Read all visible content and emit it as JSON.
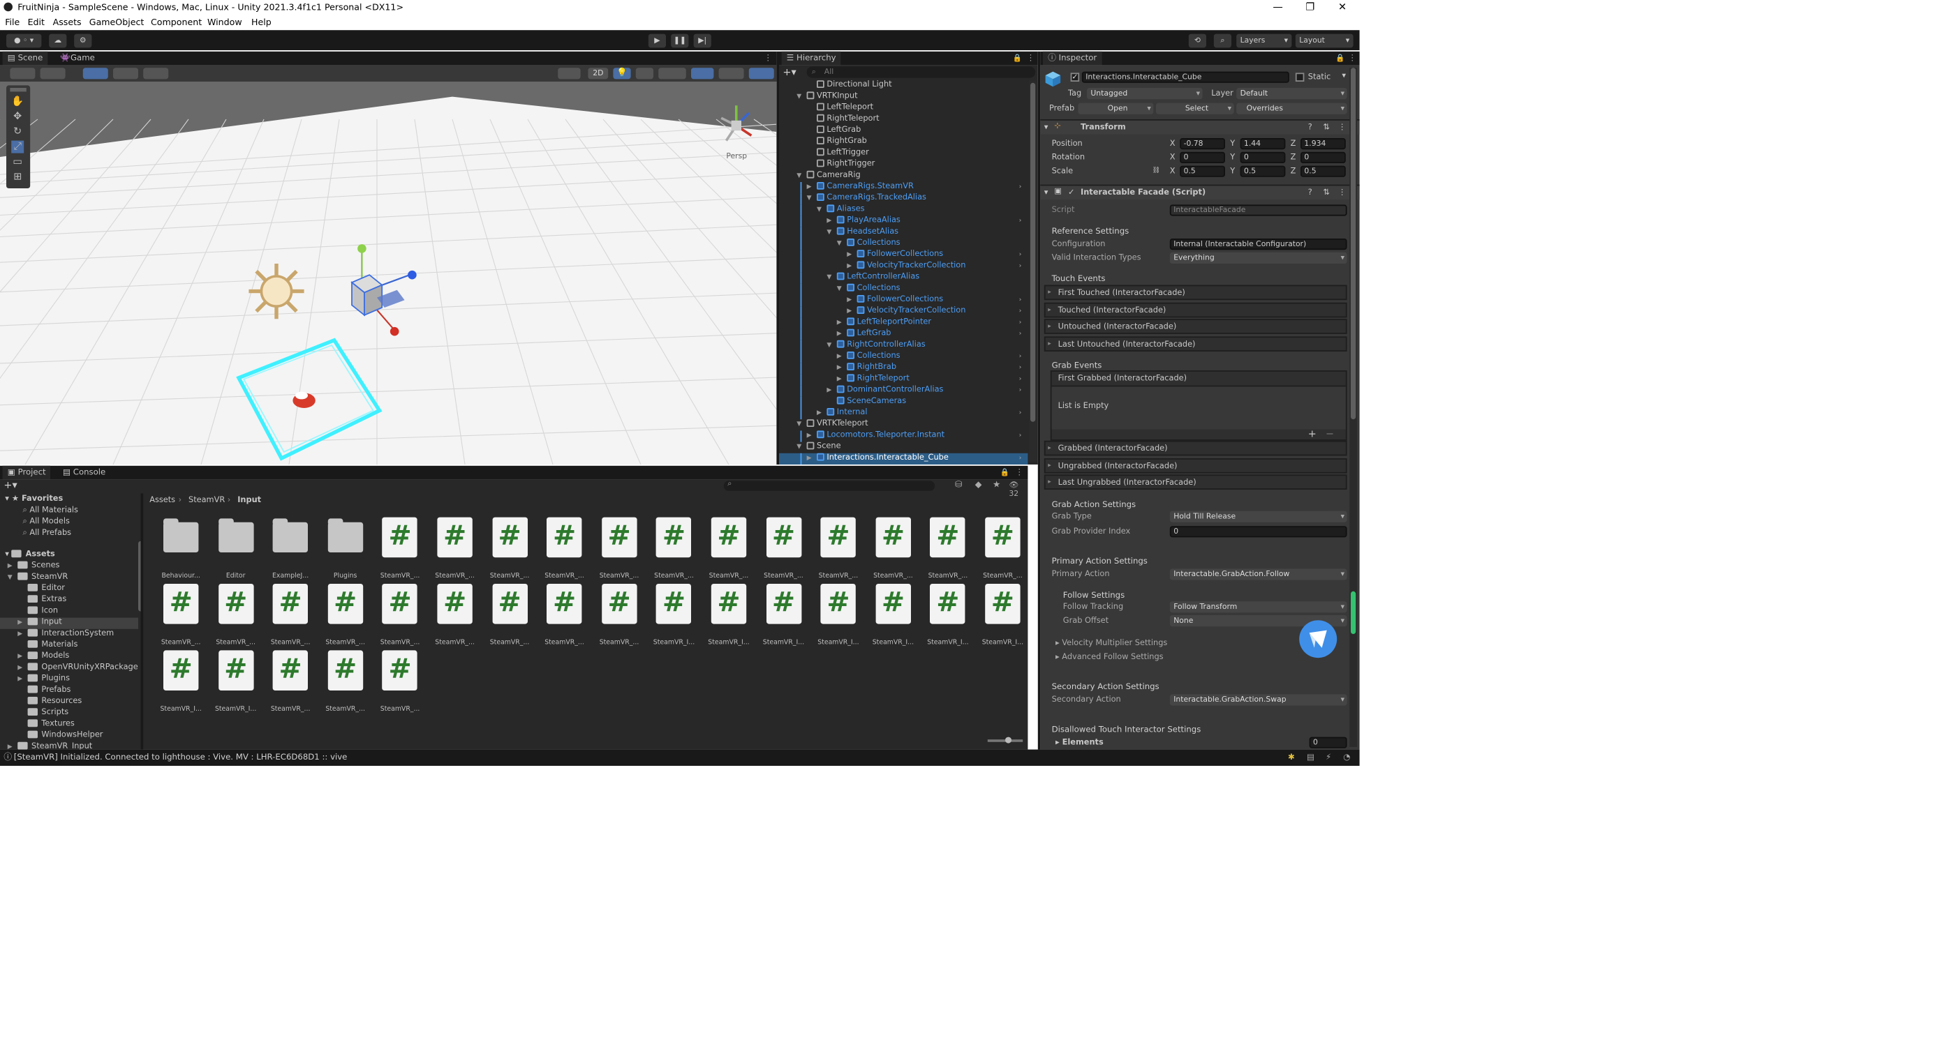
{
  "window": {
    "title": "FruitNinja - SampleScene - Windows, Mac, Linux - Unity 2021.3.4f1c1 Personal <DX11>"
  },
  "menu": [
    "File",
    "Edit",
    "Assets",
    "GameObject",
    "Component",
    "Window",
    "Help"
  ],
  "toolbar": {
    "layers": "Layers",
    "layout": "Layout"
  },
  "scene": {
    "tab_scene": "Scene",
    "tab_game": "Game",
    "persp": "Persp",
    "btn_2d": "2D"
  },
  "hierarchy": {
    "tab": "Hierarchy",
    "search": "All",
    "items": [
      {
        "label": "Directional Light",
        "indent": 2,
        "blue": false
      },
      {
        "label": "VRTKInput",
        "indent": 1,
        "blue": false,
        "open": true
      },
      {
        "label": "LeftTeleport",
        "indent": 2,
        "blue": false
      },
      {
        "label": "RightTeleport",
        "indent": 2,
        "blue": false
      },
      {
        "label": "LeftGrab",
        "indent": 2,
        "blue": false
      },
      {
        "label": "RightGrab",
        "indent": 2,
        "blue": false
      },
      {
        "label": "LeftTrigger",
        "indent": 2,
        "blue": false
      },
      {
        "label": "RightTrigger",
        "indent": 2,
        "blue": false
      },
      {
        "label": "CameraRig",
        "indent": 1,
        "blue": false,
        "open": true
      },
      {
        "label": "CameraRigs.SteamVR",
        "indent": 2,
        "blue": true,
        "closed": true
      },
      {
        "label": "CameraRigs.TrackedAlias",
        "indent": 2,
        "blue": true,
        "open": true
      },
      {
        "label": "Aliases",
        "indent": 3,
        "blue": true,
        "open": true
      },
      {
        "label": "PlayAreaAlias",
        "indent": 4,
        "blue": true,
        "closed": true
      },
      {
        "label": "HeadsetAlias",
        "indent": 4,
        "blue": true,
        "open": true
      },
      {
        "label": "Collections",
        "indent": 5,
        "blue": true,
        "open": true
      },
      {
        "label": "FollowerCollections",
        "indent": 6,
        "blue": true,
        "closed": true
      },
      {
        "label": "VelocityTrackerCollection",
        "indent": 6,
        "blue": true,
        "closed": true
      },
      {
        "label": "LeftControllerAlias",
        "indent": 4,
        "blue": true,
        "open": true
      },
      {
        "label": "Collections",
        "indent": 5,
        "blue": true,
        "open": true
      },
      {
        "label": "FollowerCollections",
        "indent": 6,
        "blue": true,
        "closed": true
      },
      {
        "label": "VelocityTrackerCollection",
        "indent": 6,
        "blue": true,
        "closed": true
      },
      {
        "label": "LeftTeleportPointer",
        "indent": 5,
        "blue": true,
        "closed": true
      },
      {
        "label": "LeftGrab",
        "indent": 5,
        "blue": true,
        "closed": true
      },
      {
        "label": "RightControllerAlias",
        "indent": 4,
        "blue": true,
        "open": true
      },
      {
        "label": "Collections",
        "indent": 5,
        "blue": true,
        "closed": true
      },
      {
        "label": "RightBrab",
        "indent": 5,
        "blue": true,
        "closed": true
      },
      {
        "label": "RightTeleport",
        "indent": 5,
        "blue": true,
        "closed": true
      },
      {
        "label": "DominantControllerAlias",
        "indent": 4,
        "blue": true,
        "closed": true
      },
      {
        "label": "SceneCameras",
        "indent": 4,
        "blue": true
      },
      {
        "label": "Internal",
        "indent": 3,
        "blue": true,
        "closed": true
      },
      {
        "label": "VRTKTeleport",
        "indent": 1,
        "blue": false,
        "open": true
      },
      {
        "label": "Locomotors.Teleporter.Instant",
        "indent": 2,
        "blue": true,
        "closed": true
      },
      {
        "label": "Scene",
        "indent": 1,
        "blue": false,
        "open": true
      },
      {
        "label": "Interactions.Interactable_Cube",
        "indent": 2,
        "blue": true,
        "closed": true,
        "selected": true
      }
    ]
  },
  "inspector": {
    "tab": "Inspector",
    "object_name": "Interactions.Interactable_Cube",
    "static": "Static",
    "tag_label": "Tag",
    "tag": "Untagged",
    "layer_label": "Layer",
    "layer": "Default",
    "prefab_label": "Prefab",
    "open": "Open",
    "select": "Select",
    "overrides": "Overrides",
    "transform": "Transform",
    "position": "Position",
    "rotation": "Rotation",
    "scale": "Scale",
    "pos": {
      "x": "-0.78",
      "y": "1.44",
      "z": "1.934"
    },
    "rot": {
      "x": "0",
      "y": "0",
      "z": "0"
    },
    "scl": {
      "x": "0.5",
      "y": "0.5",
      "z": "0.5"
    },
    "component": "Interactable Facade (Script)",
    "script_label": "Script",
    "script": "InteractableFacade",
    "ref_settings": "Reference Settings",
    "config_label": "Configuration",
    "config": "Internal (Interactable Configurator)",
    "valid_label": "Valid Interaction Types",
    "valid": "Everything",
    "touch_events": "Touch Events",
    "touch_list": [
      "First Touched (InteractorFacade)",
      "Touched (InteractorFacade)",
      "Untouched (InteractorFacade)",
      "Last Untouched (InteractorFacade)"
    ],
    "grab_events": "Grab Events",
    "first_grabbed": "First Grabbed (InteractorFacade)",
    "list_empty": "List is Empty",
    "grab_list": [
      "Grabbed (InteractorFacade)",
      "Ungrabbed (InteractorFacade)",
      "Last Ungrabbed (InteractorFacade)"
    ],
    "grab_action": "Grab Action Settings",
    "grab_type_label": "Grab Type",
    "grab_type": "Hold Till Release",
    "grab_provider_label": "Grab Provider Index",
    "grab_provider": "0",
    "primary_settings": "Primary Action Settings",
    "primary_label": "Primary Action",
    "primary": "Interactable.GrabAction.Follow",
    "follow_settings": "Follow Settings",
    "follow_tracking_label": "Follow Tracking",
    "follow_tracking": "Follow Transform",
    "grab_offset_label": "Grab Offset",
    "grab_offset": "None",
    "velocity_mult": "Velocity Multiplier Settings",
    "adv_follow": "Advanced Follow Settings",
    "secondary_settings": "Secondary Action Settings",
    "secondary_label": "Secondary Action",
    "secondary": "Interactable.GrabAction.Swap",
    "disallowed": "Disallowed Touch Interactor Settings",
    "elements_label": "Elements",
    "elements": "0"
  },
  "project": {
    "tab_project": "Project",
    "tab_console": "Console",
    "favorites": "Favorites",
    "fav_items": [
      "All Materials",
      "All Models",
      "All Prefabs"
    ],
    "assets": "Assets",
    "tree": [
      {
        "label": "Scenes",
        "indent": 1
      },
      {
        "label": "SteamVR",
        "indent": 1,
        "open": true
      },
      {
        "label": "Editor",
        "indent": 2
      },
      {
        "label": "Extras",
        "indent": 2
      },
      {
        "label": "Icon",
        "indent": 2
      },
      {
        "label": "Input",
        "indent": 2,
        "selected": true
      },
      {
        "label": "InteractionSystem",
        "indent": 2
      },
      {
        "label": "Materials",
        "indent": 2
      },
      {
        "label": "Models",
        "indent": 2
      },
      {
        "label": "OpenVRUnityXRPackage",
        "indent": 2
      },
      {
        "label": "Plugins",
        "indent": 2
      },
      {
        "label": "Prefabs",
        "indent": 2
      },
      {
        "label": "Resources",
        "indent": 2
      },
      {
        "label": "Scripts",
        "indent": 2
      },
      {
        "label": "Textures",
        "indent": 2
      },
      {
        "label": "WindowsHelper",
        "indent": 2
      },
      {
        "label": "SteamVR_Input",
        "indent": 1
      }
    ],
    "breadcrumb": [
      "Assets",
      "SteamVR",
      "Input"
    ],
    "count": "32",
    "items": [
      {
        "type": "folder",
        "label": "Behaviour..."
      },
      {
        "type": "folder",
        "label": "Editor"
      },
      {
        "type": "folder",
        "label": "ExampleJ..."
      },
      {
        "type": "folder",
        "label": "Plugins"
      },
      {
        "type": "script",
        "label": "SteamVR_..."
      },
      {
        "type": "script",
        "label": "SteamVR_..."
      },
      {
        "type": "script",
        "label": "SteamVR_..."
      },
      {
        "type": "script",
        "label": "SteamVR_..."
      },
      {
        "type": "script",
        "label": "SteamVR_..."
      },
      {
        "type": "script",
        "label": "SteamVR_..."
      },
      {
        "type": "script",
        "label": "SteamVR_..."
      },
      {
        "type": "script",
        "label": "SteamVR_..."
      },
      {
        "type": "script",
        "label": "SteamVR_..."
      },
      {
        "type": "script",
        "label": "SteamVR_..."
      },
      {
        "type": "script",
        "label": "SteamVR_..."
      },
      {
        "type": "script",
        "label": "SteamVR_..."
      },
      {
        "type": "script",
        "label": "SteamVR_..."
      },
      {
        "type": "script",
        "label": "SteamVR_..."
      },
      {
        "type": "script",
        "label": "SteamVR_..."
      },
      {
        "type": "script",
        "label": "SteamVR_..."
      },
      {
        "type": "script",
        "label": "SteamVR_..."
      },
      {
        "type": "script",
        "label": "SteamVR_..."
      },
      {
        "type": "script",
        "label": "SteamVR_..."
      },
      {
        "type": "script",
        "label": "SteamVR_..."
      },
      {
        "type": "script",
        "label": "SteamVR_..."
      },
      {
        "type": "script",
        "label": "SteamVR_I..."
      },
      {
        "type": "script",
        "label": "SteamVR_I..."
      },
      {
        "type": "script",
        "label": "SteamVR_I..."
      },
      {
        "type": "script",
        "label": "SteamVR_I..."
      },
      {
        "type": "script",
        "label": "SteamVR_I..."
      },
      {
        "type": "script",
        "label": "SteamVR_I..."
      },
      {
        "type": "script",
        "label": "SteamVR_I..."
      },
      {
        "type": "script",
        "label": "SteamVR_I..."
      },
      {
        "type": "script",
        "label": "SteamVR_I..."
      },
      {
        "type": "script",
        "label": "SteamVR_..."
      },
      {
        "type": "script",
        "label": "SteamVR_..."
      },
      {
        "type": "script",
        "label": "SteamVR_..."
      }
    ]
  },
  "status": "[SteamVR] Initialized. Connected to lighthouse : Vive. MV : LHR-EC6D68D1 :: vive"
}
